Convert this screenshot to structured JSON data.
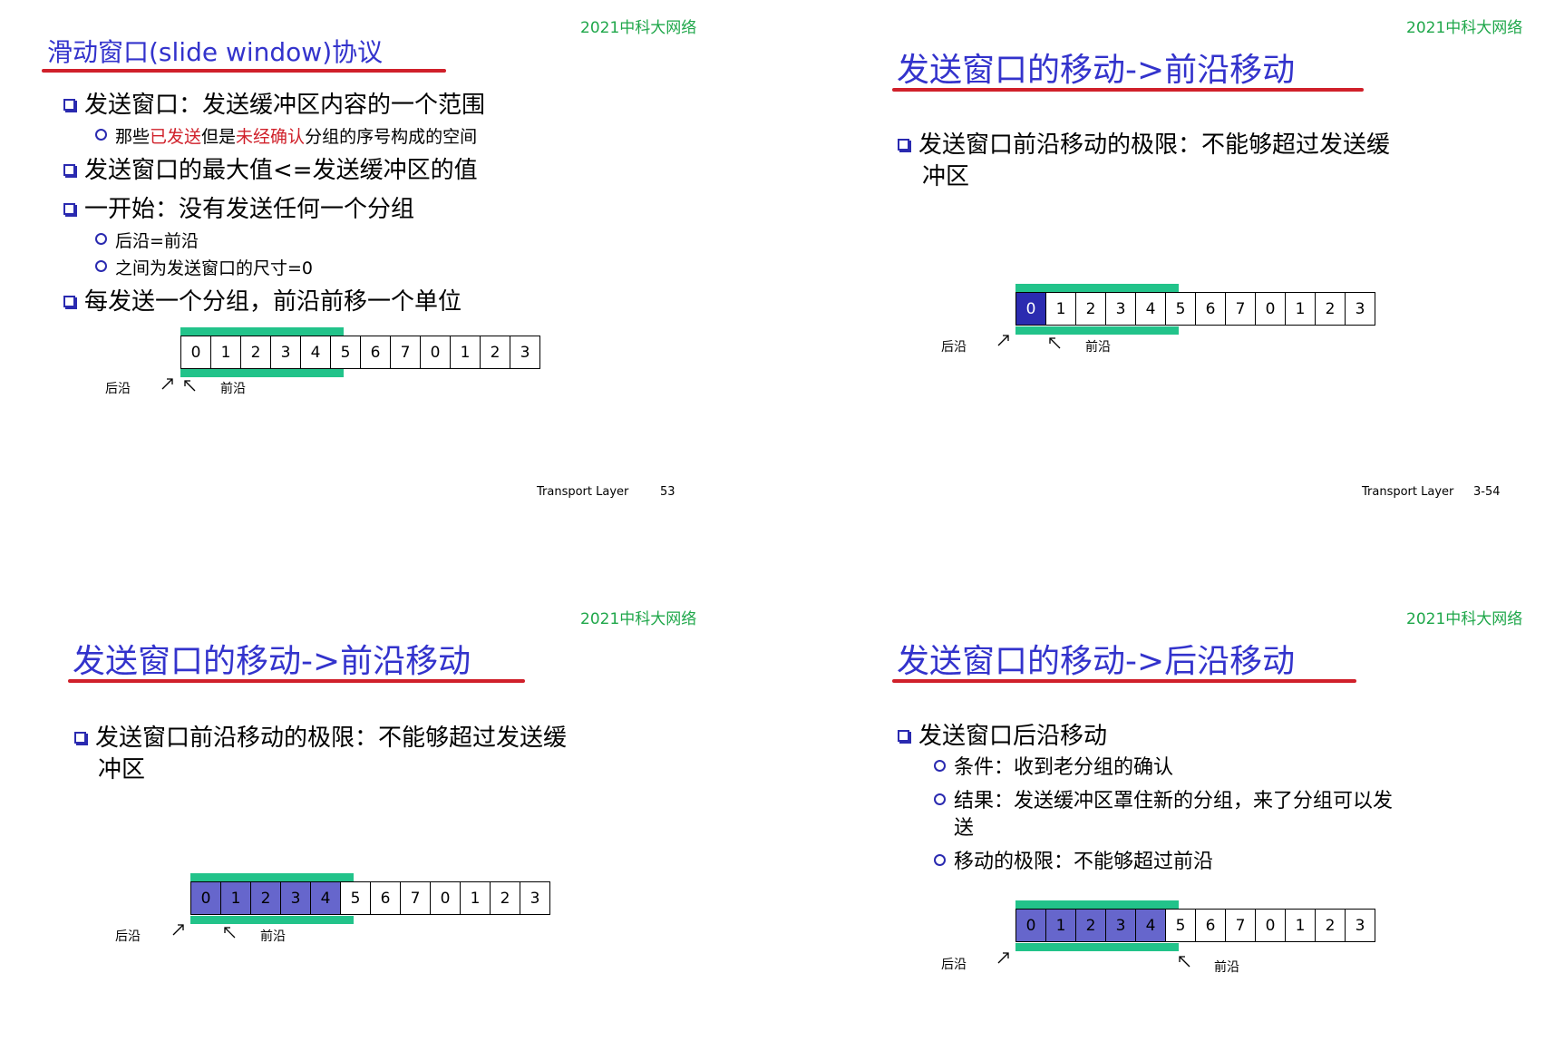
{
  "slides": [
    {
      "course_tag": "2021中科大网络",
      "title": "滑动窗口(slide window)协议",
      "bullets": [
        {
          "level": 1,
          "text": "发送窗口：发送缓冲区内容的一个范围"
        },
        {
          "level": 2,
          "parts": [
            "那些",
            "已发送",
            "但是",
            "未经确认",
            "分组的序号构成的空间"
          ]
        },
        {
          "level": 1,
          "text": "发送窗口的最大值<=发送缓冲区的值"
        },
        {
          "level": 1,
          "text": "一开始：没有发送任何一个分组"
        },
        {
          "level": 2,
          "text": "后沿=前沿"
        },
        {
          "level": 2,
          "text": "之间为发送窗口的尺寸=0"
        },
        {
          "level": 1,
          "text": "每发送一个分组，前沿前移一个单位"
        }
      ],
      "sequence": [
        "0",
        "1",
        "2",
        "3",
        "4",
        "5",
        "6",
        "7",
        "0",
        "1",
        "2",
        "3"
      ],
      "rear_label": "后沿",
      "front_label": "前沿",
      "footer_label": "Transport Layer",
      "page": "53"
    },
    {
      "course_tag": "2021中科大网络",
      "title": "发送窗口的移动->前沿移动",
      "bullets": [
        {
          "level": 1,
          "text": "发送窗口前沿移动的极限：不能够超过发送缓",
          "cont": "冲区"
        }
      ],
      "sequence": [
        "0",
        "1",
        "2",
        "3",
        "4",
        "5",
        "6",
        "7",
        "0",
        "1",
        "2",
        "3"
      ],
      "rear_label": "后沿",
      "front_label": "前沿",
      "footer_label": "Transport Layer",
      "page": "3-54"
    },
    {
      "course_tag": "2021中科大网络",
      "title": "发送窗口的移动->前沿移动",
      "bullets": [
        {
          "level": 1,
          "text": "发送窗口前沿移动的极限：不能够超过发送缓",
          "cont": "冲区"
        }
      ],
      "sequence": [
        "0",
        "1",
        "2",
        "3",
        "4",
        "5",
        "6",
        "7",
        "0",
        "1",
        "2",
        "3"
      ],
      "rear_label": "后沿",
      "front_label": "前沿"
    },
    {
      "course_tag": "2021中科大网络",
      "title": "发送窗口的移动->后沿移动",
      "bullets": [
        {
          "level": 1,
          "text": "发送窗口后沿移动"
        },
        {
          "level": 2,
          "text": "条件：收到老分组的确认"
        },
        {
          "level": 2,
          "text": "结果：发送缓冲区罩住新的分组，来了分组可以发",
          "cont": "送"
        },
        {
          "level": 2,
          "text": "移动的极限：不能够超过前沿"
        }
      ],
      "sequence": [
        "0",
        "1",
        "2",
        "3",
        "4",
        "5",
        "6",
        "7",
        "0",
        "1",
        "2",
        "3"
      ],
      "rear_label": "后沿",
      "front_label": "前沿"
    }
  ],
  "colors": {
    "title": "#3333cc",
    "underline": "#d0202a",
    "course_tag": "#1fa74a",
    "window_band": "#22c38a",
    "unacked_cell": "#6666cc",
    "sent_cell": "#2b2bb0"
  },
  "icons": [
    "square-bullet-icon",
    "circle-bullet-icon",
    "arrow-icon"
  ]
}
